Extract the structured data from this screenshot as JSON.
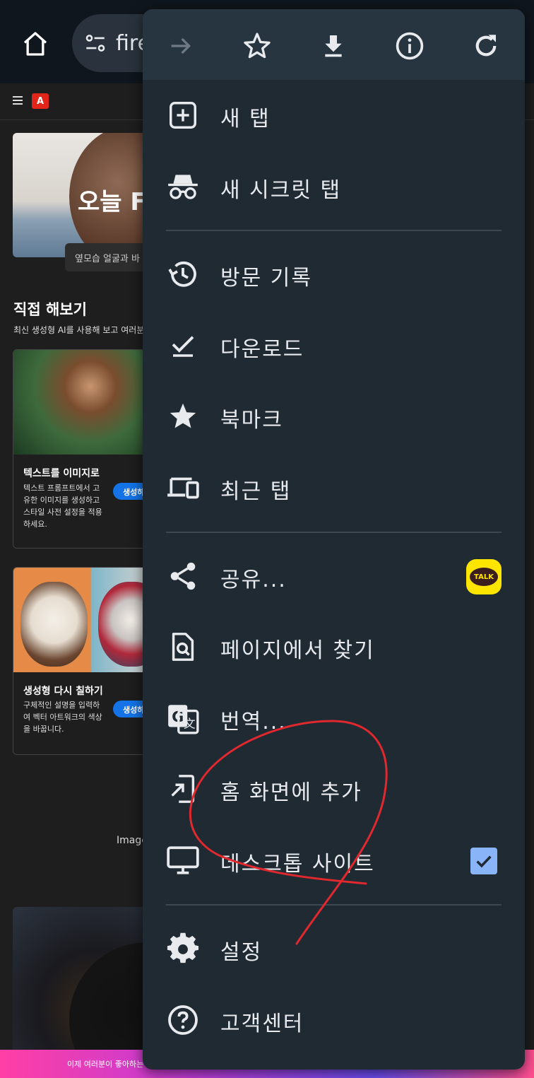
{
  "browser": {
    "url_text": "fire",
    "home_icon": "home-icon",
    "site_settings_icon": "tune-icon"
  },
  "page": {
    "hero_title": "오늘 F",
    "hero_caption": "옆모습 얼굴과 바",
    "section_title": "직접 해보기",
    "section_subtitle": "최신 생성형 AI를 사용해 보고 여러분",
    "cards": [
      {
        "title": "텍스트를 이미지로",
        "description": "텍스트 프롬프트에서 고유한 이미지를 생성하고 스타일 사전 설정을 적용하세요.",
        "button": "생성하"
      },
      {
        "title": "생성형 다시 칠하기",
        "description": "구체적인 설명을 입력하여 벡터 아트워크의 색상을 바꿉니다.",
        "button": "생성하"
      }
    ],
    "image_label": "Image",
    "promo_text": "이제 여러분이 좋아하는"
  },
  "menu": {
    "toolbar": [
      "forward-icon",
      "bookmark-star-icon",
      "download-icon",
      "info-icon",
      "reload-icon"
    ],
    "items": [
      {
        "label": "새 탭",
        "icon": "new-tab-icon"
      },
      {
        "label": "새 시크릿 탭",
        "icon": "incognito-icon"
      },
      {
        "label": "방문 기록",
        "icon": "history-icon"
      },
      {
        "label": "다운로드",
        "icon": "downloads-icon"
      },
      {
        "label": "북마크",
        "icon": "bookmarks-icon"
      },
      {
        "label": "최근 탭",
        "icon": "recent-tabs-icon"
      },
      {
        "label": "공유...",
        "icon": "share-icon",
        "badge": "TALK"
      },
      {
        "label": "페이지에서 찾기",
        "icon": "find-in-page-icon"
      },
      {
        "label": "번역...",
        "icon": "translate-icon"
      },
      {
        "label": "홈 화면에 추가",
        "icon": "add-to-home-screen-icon"
      },
      {
        "label": "데스크톱 사이트",
        "icon": "desktop-icon",
        "checked": true
      },
      {
        "label": "설정",
        "icon": "settings-icon"
      },
      {
        "label": "고객센터",
        "icon": "help-icon"
      }
    ]
  },
  "colors": {
    "menu_bg": "#1f2a33",
    "menu_toolbar_bg": "#263540",
    "annotation": "#e0282e",
    "checkbox": "#8ab4f8",
    "kakao": "#fee500"
  }
}
